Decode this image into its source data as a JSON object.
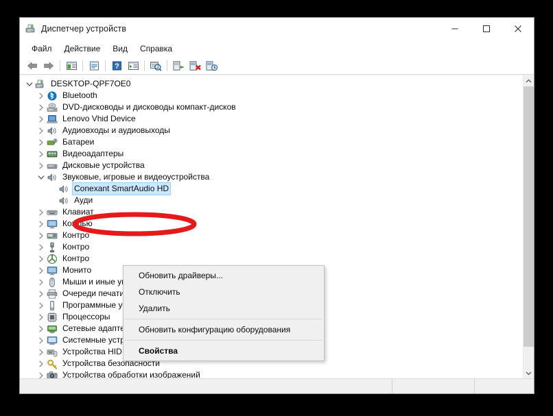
{
  "window": {
    "title": "Диспетчер устройств",
    "title_icon": "device-manager-icon",
    "controls": {
      "minimize": "minimize-icon",
      "maximize": "maximize-icon",
      "close": "close-icon"
    }
  },
  "menubar": {
    "items": [
      {
        "label": "Файл"
      },
      {
        "label": "Действие"
      },
      {
        "label": "Вид"
      },
      {
        "label": "Справка"
      }
    ]
  },
  "toolbar": {
    "buttons": [
      {
        "icon": "back-arrow-icon",
        "label": "Назад"
      },
      {
        "icon": "forward-arrow-icon",
        "label": "Вперёд"
      },
      {
        "icon": "show-hide-console-tree-icon",
        "label": "Показать или скрыть дерево консоли"
      },
      {
        "icon": "properties-icon",
        "label": "Свойства"
      },
      {
        "icon": "help-icon",
        "label": "Справка"
      },
      {
        "icon": "view-icon",
        "label": "Вид"
      },
      {
        "icon": "scan-hardware-changes-icon",
        "label": "Обновить конфигурацию оборудования"
      },
      {
        "icon": "update-driver-icon",
        "label": "Обновить драйверы"
      },
      {
        "icon": "uninstall-device-icon",
        "label": "Удалить устройство"
      },
      {
        "icon": "disable-device-icon",
        "label": "Отключить устройство"
      }
    ]
  },
  "tree": {
    "nodes": [
      {
        "label": "DESKTOP-QPF7OE0",
        "indent": 0,
        "expander": "expanded",
        "icon": "computer-icon",
        "selected": false
      },
      {
        "label": "Bluetooth",
        "indent": 1,
        "expander": "collapsed",
        "icon": "bluetooth-icon",
        "selected": false
      },
      {
        "label": "DVD-дисководы и дисководы компакт-дисков",
        "indent": 1,
        "expander": "collapsed",
        "icon": "dvd-drive-icon",
        "selected": false
      },
      {
        "label": "Lenovo Vhid Device",
        "indent": 1,
        "expander": "collapsed",
        "icon": "laptop-icon",
        "selected": false
      },
      {
        "label": "Аудиовходы и аудиовыходы",
        "indent": 1,
        "expander": "collapsed",
        "icon": "speaker-icon",
        "selected": false
      },
      {
        "label": "Батареи",
        "indent": 1,
        "expander": "collapsed",
        "icon": "battery-icon",
        "selected": false
      },
      {
        "label": "Видеоадаптеры",
        "indent": 1,
        "expander": "collapsed",
        "icon": "display-adapter-icon",
        "selected": false
      },
      {
        "label": "Дисковые устройства",
        "indent": 1,
        "expander": "collapsed",
        "icon": "disk-drive-icon",
        "selected": false
      },
      {
        "label": "Звуковые, игровые и видеоустройства",
        "indent": 1,
        "expander": "expanded",
        "icon": "speaker-icon",
        "selected": false
      },
      {
        "label": "Conexant SmartAudio HD",
        "indent": 2,
        "expander": "none",
        "icon": "speaker-icon",
        "selected": true
      },
      {
        "label": "Ауди",
        "indent": 2,
        "expander": "none",
        "icon": "speaker-icon",
        "selected": false
      },
      {
        "label": "Клавиат",
        "indent": 1,
        "expander": "collapsed",
        "icon": "keyboard-icon",
        "selected": false
      },
      {
        "label": "Компью",
        "indent": 1,
        "expander": "collapsed",
        "icon": "monitor-icon",
        "selected": false
      },
      {
        "label": "Контро",
        "indent": 1,
        "expander": "collapsed",
        "icon": "storage-controller-icon",
        "selected": false
      },
      {
        "label": "Контро",
        "indent": 1,
        "expander": "collapsed",
        "icon": "usb-controller-icon",
        "selected": false
      },
      {
        "label": "Контро",
        "indent": 1,
        "expander": "collapsed",
        "icon": "ieee1394-controller-icon",
        "selected": false
      },
      {
        "label": "Монито",
        "indent": 1,
        "expander": "collapsed",
        "icon": "monitor-icon",
        "selected": false
      },
      {
        "label": "Мыши и иные указывающие устройства",
        "indent": 1,
        "expander": "collapsed",
        "icon": "mouse-icon",
        "selected": false
      },
      {
        "label": "Очереди печати",
        "indent": 1,
        "expander": "collapsed",
        "icon": "printer-icon",
        "selected": false
      },
      {
        "label": "Программные устройства",
        "indent": 1,
        "expander": "collapsed",
        "icon": "software-device-icon",
        "selected": false
      },
      {
        "label": "Процессоры",
        "indent": 1,
        "expander": "collapsed",
        "icon": "processor-icon",
        "selected": false
      },
      {
        "label": "Сетевые адаптеры",
        "indent": 1,
        "expander": "collapsed",
        "icon": "network-adapter-icon",
        "selected": false
      },
      {
        "label": "Системные устройства",
        "indent": 1,
        "expander": "collapsed",
        "icon": "system-device-icon",
        "selected": false
      },
      {
        "label": "Устройства HID (Human Interface Devices)",
        "indent": 1,
        "expander": "collapsed",
        "icon": "hid-device-icon",
        "selected": false
      },
      {
        "label": "Устройства безопасности",
        "indent": 1,
        "expander": "collapsed",
        "icon": "security-device-icon",
        "selected": false
      },
      {
        "label": "Устройства обработки изображений",
        "indent": 1,
        "expander": "collapsed",
        "icon": "imaging-device-icon",
        "selected": false
      }
    ]
  },
  "context_menu": {
    "items": [
      {
        "label": "Обновить драйверы...",
        "bold": false,
        "separator_after": false
      },
      {
        "label": "Отключить",
        "bold": false,
        "separator_after": false
      },
      {
        "label": "Удалить",
        "bold": false,
        "separator_after": true
      },
      {
        "label": "Обновить конфигурацию оборудования",
        "bold": false,
        "separator_after": true
      },
      {
        "label": "Свойства",
        "bold": true,
        "separator_after": false
      }
    ]
  },
  "annotation": {
    "shape": "ellipse",
    "color": "#e51a1a",
    "targets": "Удалить"
  },
  "scrollbar": {
    "up_arrow": "chevron-up-icon",
    "down_arrow": "chevron-down-icon"
  },
  "statusbar": {
    "pane1": "",
    "pane2": "",
    "pane3": ""
  },
  "colors": {
    "selection": "#cce8ff",
    "annotation_red": "#e51a1a",
    "menu_bg": "#f0f0f0",
    "window_bg": "#ffffff",
    "page_bg": "#000000"
  }
}
